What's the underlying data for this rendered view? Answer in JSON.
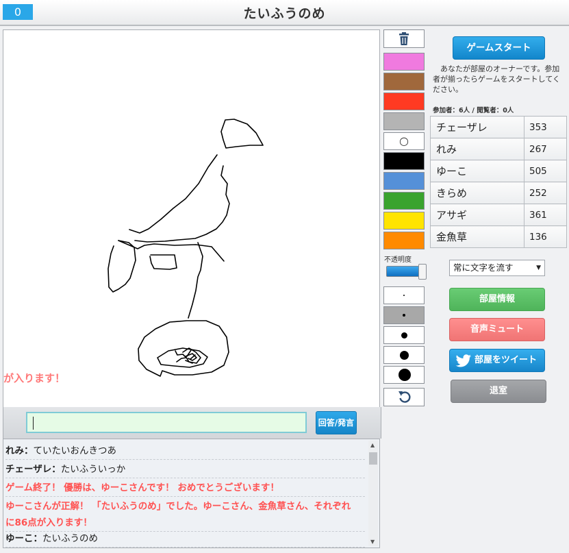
{
  "header": {
    "score": "0",
    "title": "たいふうのめ"
  },
  "canvas": {
    "ticker": "が入ります！"
  },
  "answer": {
    "value": "",
    "button_label": "回答/発言"
  },
  "chat": [
    {
      "user": "れみ",
      "text": "ていたいおんきつあ"
    },
    {
      "user": "チェーザレ",
      "text": "たいふういっか"
    },
    {
      "system": "ゲーム終了！ 優勝は、ゆーこさんです！ おめでとうございます！"
    },
    {
      "system_line1": "ゆーこさんが正解！ 「たいふうのめ」でした。ゆーこさん、金魚草さん、それぞれ",
      "system_line2": "に86点が入ります！"
    },
    {
      "user": "ゆーこ",
      "text": "たいふうのめ"
    }
  ],
  "tools": {
    "eraser_icon": "trash-icon",
    "colors": [
      "#f07adf",
      "#a0683c",
      "#ff3a22",
      "#b4b4b4",
      "#ffffff",
      "#000000",
      "#5590d8",
      "#3aa32e",
      "#ffe400",
      "#ff8a00"
    ],
    "white_label": "○",
    "opacity_label": "不透明度",
    "opacity_value": 1.0,
    "undo_icon": "undo-icon"
  },
  "panel": {
    "start_label": "ゲームスタート",
    "owner_note": "あなたが部屋のオーナーです。参加者が揃ったらゲームをスタートしてください。",
    "participants_text": "参加者：6人 / 閲覧者：0人",
    "players": [
      {
        "name": "チェーザレ",
        "score": "353"
      },
      {
        "name": "れみ",
        "score": "267"
      },
      {
        "name": "ゆーこ",
        "score": "505"
      },
      {
        "name": "きらめ",
        "score": "252"
      },
      {
        "name": "アサギ",
        "score": "361"
      },
      {
        "name": "金魚草",
        "score": "136"
      }
    ],
    "select_value": "常に文字を流す",
    "info_label": "部屋情報",
    "mute_label": "音声ミュート",
    "tweet_label": "部屋をツイート",
    "exit_label": "退室"
  }
}
